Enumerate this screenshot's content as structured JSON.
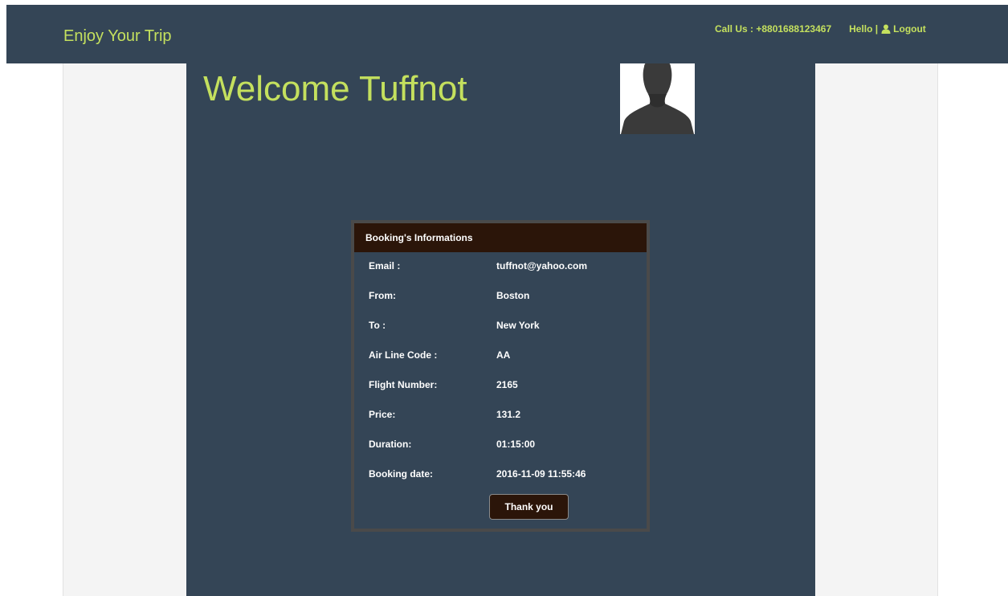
{
  "navbar": {
    "brand": "Enjoy Your Trip",
    "call_us": "Call Us : +8801688123467",
    "hello": "Hello |",
    "user_icon": "user-icon",
    "logout": "Logout",
    "accent_color": "#c4e05e",
    "background_color": "#344556"
  },
  "main": {
    "welcome": "Welcome Tuffnot",
    "avatar_icon": "user-silhouette"
  },
  "booking": {
    "title": "Booking's Informations",
    "rows": [
      {
        "label": "Email :",
        "value": "tuffnot@yahoo.com"
      },
      {
        "label": "From:",
        "value": "Boston"
      },
      {
        "label": "To :",
        "value": "New York"
      },
      {
        "label": "Air Line Code :",
        "value": "AA"
      },
      {
        "label": "Flight Number:",
        "value": "2165"
      },
      {
        "label": "Price:",
        "value": "131.2"
      },
      {
        "label": "Duration:",
        "value": "01:15:00"
      },
      {
        "label": "Booking date:",
        "value": "2016-11-09 11:55:46"
      }
    ],
    "button_label": "Thank you",
    "header_color": "#2b1509"
  }
}
